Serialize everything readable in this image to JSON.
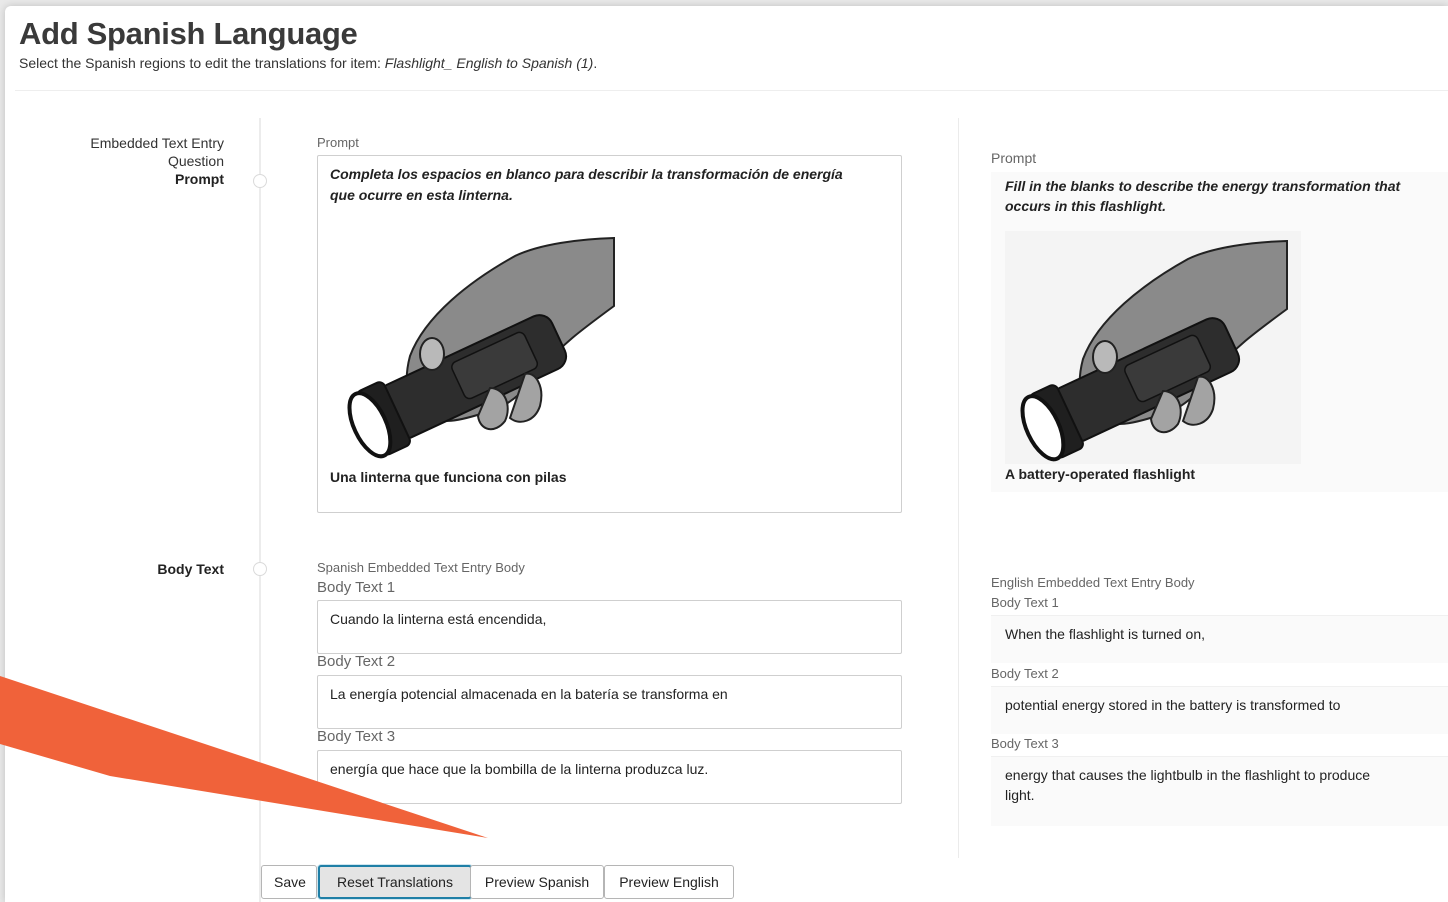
{
  "header": {
    "title": "Add Spanish Language",
    "subtitle_prefix": "Select the Spanish regions to edit the translations for item: ",
    "subtitle_item": "Flashlight_ English to Spanish (1)",
    "subtitle_suffix": "."
  },
  "sections": {
    "prompt_section": {
      "label_line1": "Embedded Text Entry",
      "label_line2": "Question",
      "label_bold": "Prompt"
    },
    "body_section": {
      "label_bold": "Body Text"
    }
  },
  "spanish": {
    "prompt_label": "Prompt",
    "prompt_text_line1": "Completa los espacios en blanco para describir la transformación de energía",
    "prompt_text_line2": "que ocurre en esta linterna.",
    "image_caption": "Una linterna que funciona con pilas",
    "body_header": "Spanish Embedded Text Entry Body",
    "body_fields": [
      {
        "label": "Body Text 1",
        "value": "Cuando la linterna está encendida,"
      },
      {
        "label": "Body Text 2",
        "value": "La energía potencial almacenada en la batería se transforma en"
      },
      {
        "label": "Body Text 3",
        "value": "energía que hace que la bombilla de la linterna produzca luz."
      }
    ]
  },
  "english": {
    "prompt_label": "Prompt",
    "prompt_text_line1": "Fill in the blanks to describe the energy transformation that",
    "prompt_text_line2": "occurs in this flashlight.",
    "image_caption": "A battery-operated flashlight",
    "body_header": "English Embedded Text Entry Body",
    "body_fields": [
      {
        "label": "Body Text 1",
        "value": "When the flashlight is turned on,"
      },
      {
        "label": "Body Text 2",
        "value": "potential energy stored in the battery is transformed to"
      },
      {
        "label": "Body Text 3",
        "value_line1": "energy that causes the lightbulb in the flashlight to produce",
        "value_line2": "light."
      }
    ]
  },
  "buttons": {
    "save": "Save",
    "reset": "Reset Translations",
    "preview_spanish": "Preview Spanish",
    "preview_english": "Preview English"
  },
  "colors": {
    "accent_border": "#1f7fa6",
    "annotation_arrow": "#f0623a"
  },
  "icons": {
    "flashlight_image": "flashlight-illustration",
    "annotation": "pointer-arrow-annotation"
  }
}
